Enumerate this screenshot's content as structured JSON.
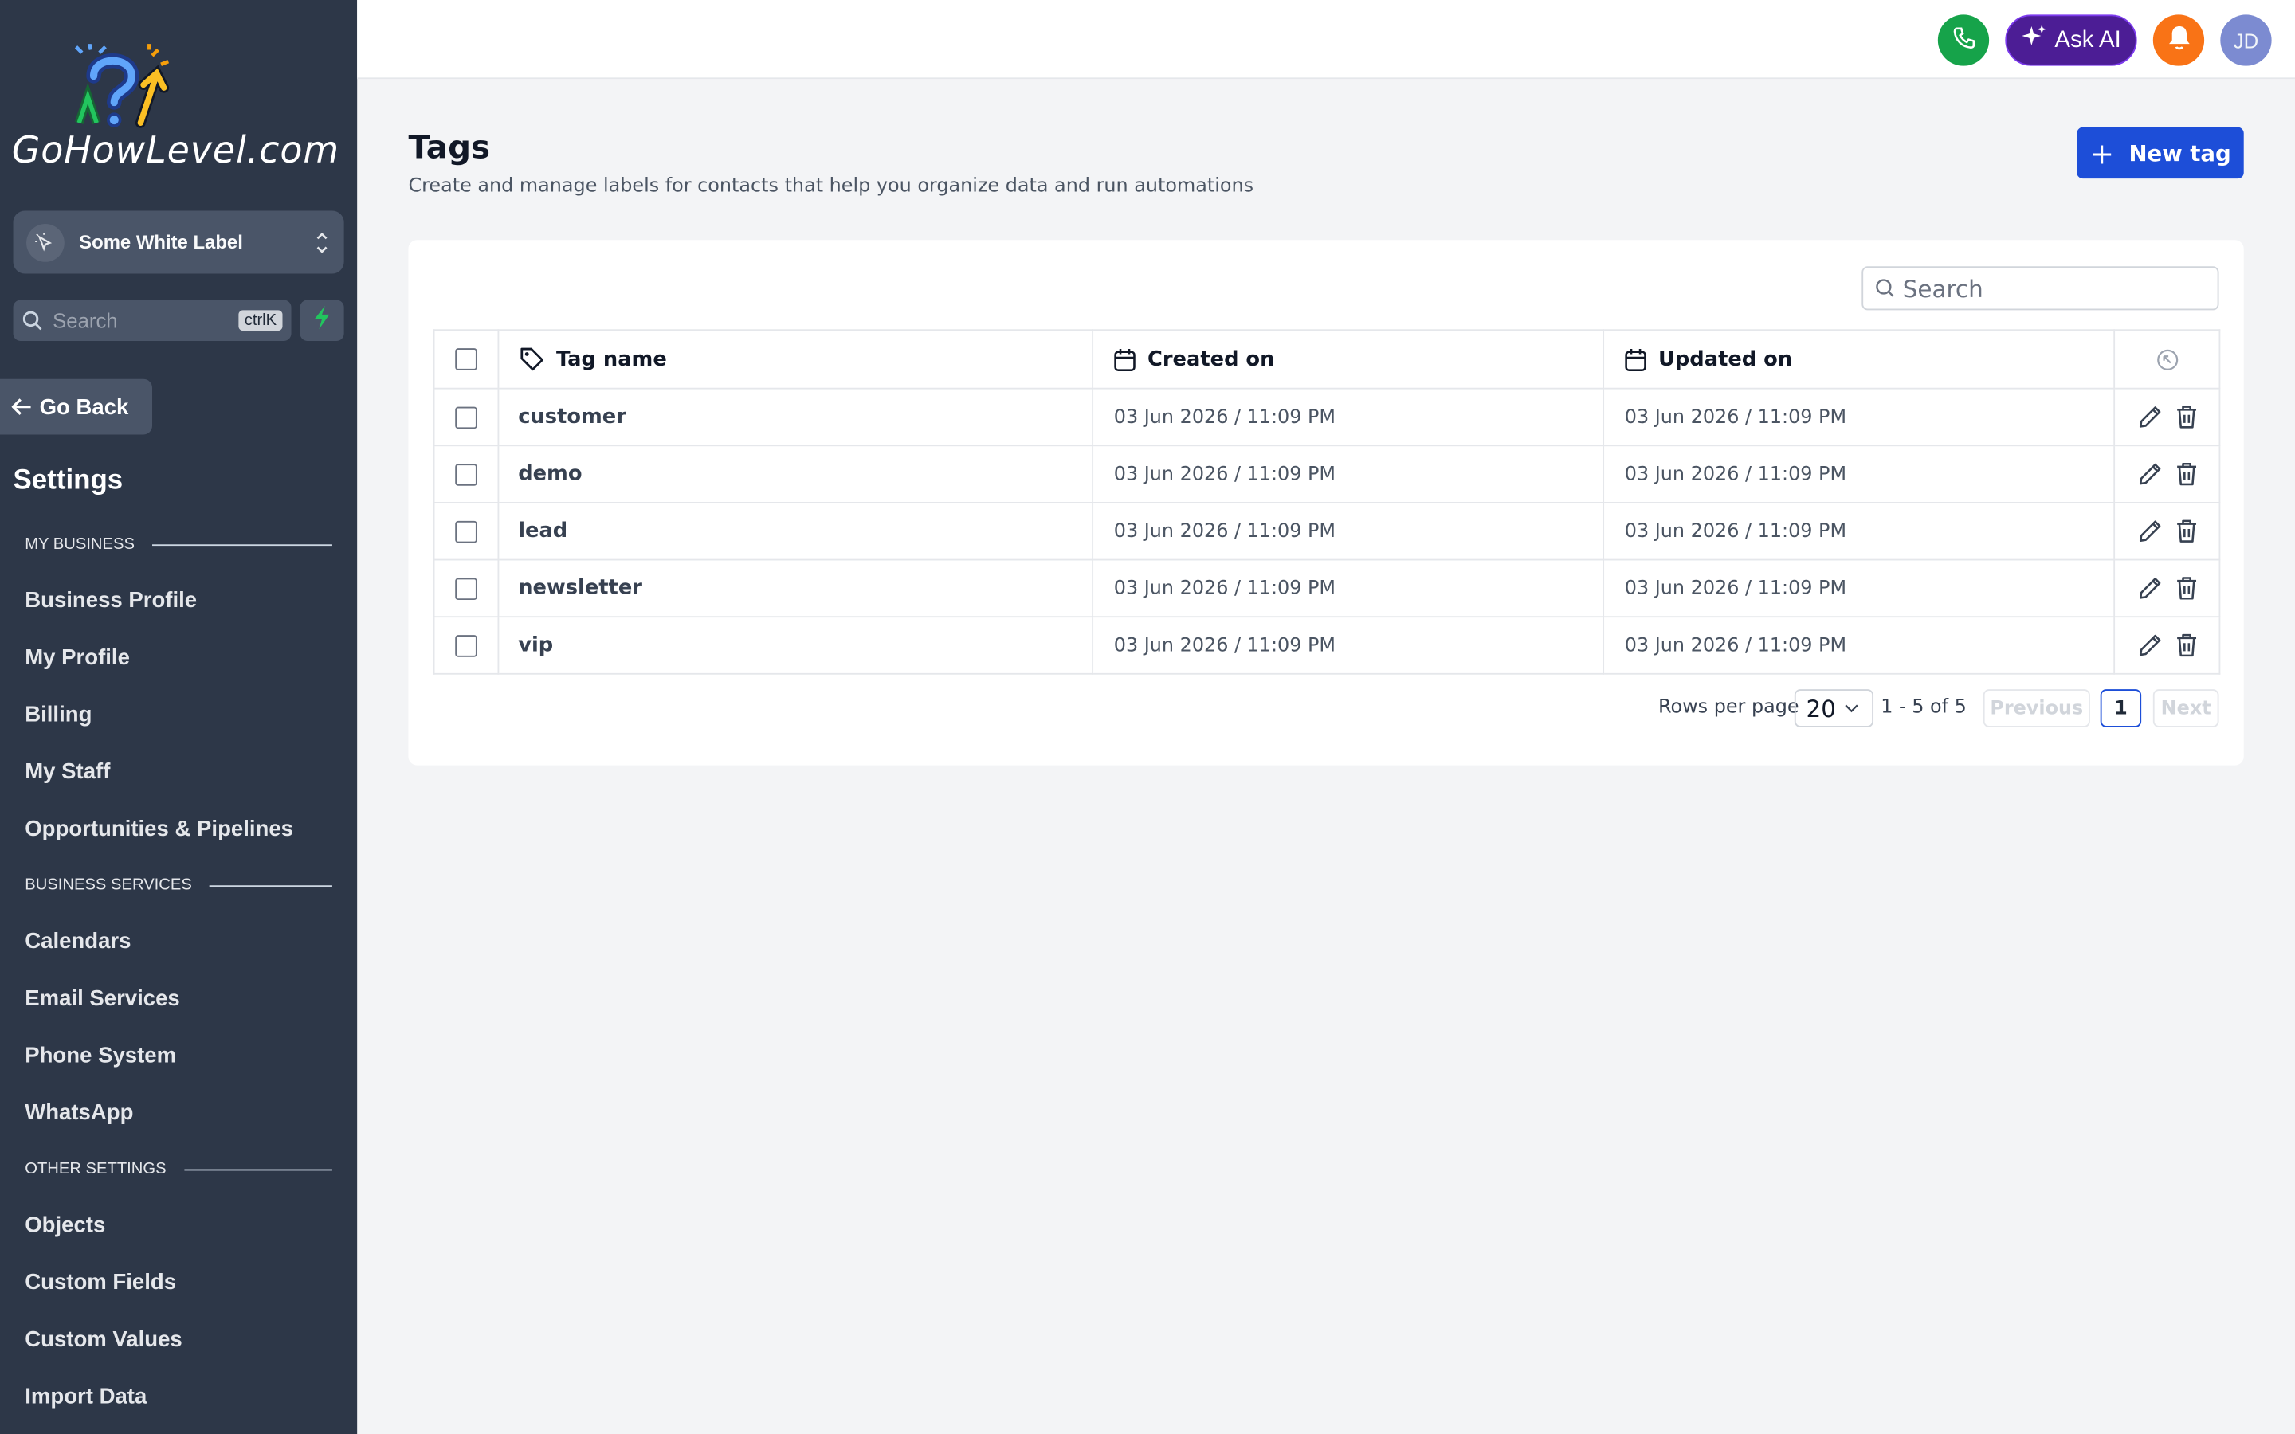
{
  "brand": {
    "logo_text": "GoHowLevel.com"
  },
  "sidebar": {
    "account_name": "Some White Label",
    "search_placeholder": "Search",
    "search_shortcut": "ctrlK",
    "go_back": "Go Back",
    "title": "Settings",
    "sections": [
      {
        "label": "MY BUSINESS",
        "items": [
          "Business Profile",
          "My Profile",
          "Billing",
          "My Staff",
          "Opportunities & Pipelines"
        ]
      },
      {
        "label": "BUSINESS SERVICES",
        "items": [
          "Calendars",
          "Email Services",
          "Phone System",
          "WhatsApp"
        ]
      },
      {
        "label": "OTHER SETTINGS",
        "items": [
          "Objects",
          "Custom Fields",
          "Custom Values",
          "Import Data"
        ]
      }
    ]
  },
  "topbar": {
    "ask_ai": "Ask AI",
    "avatar_initials": "JD",
    "phone_color": "#16a34a",
    "ai_color": "#4c1d95",
    "bell_color": "#f97316"
  },
  "page": {
    "title": "Tags",
    "subtitle": "Create and manage labels for contacts that help you organize data and run automations",
    "new_button": "New tag",
    "search_placeholder": "Search"
  },
  "table": {
    "columns": [
      "Tag name",
      "Created on",
      "Updated on"
    ],
    "rows": [
      {
        "name": "customer",
        "created": "03 Jun 2026 / 11:09 PM",
        "updated": "03 Jun 2026 / 11:09 PM"
      },
      {
        "name": "demo",
        "created": "03 Jun 2026 / 11:09 PM",
        "updated": "03 Jun 2026 / 11:09 PM"
      },
      {
        "name": "lead",
        "created": "03 Jun 2026 / 11:09 PM",
        "updated": "03 Jun 2026 / 11:09 PM"
      },
      {
        "name": "newsletter",
        "created": "03 Jun 2026 / 11:09 PM",
        "updated": "03 Jun 2026 / 11:09 PM"
      },
      {
        "name": "vip",
        "created": "03 Jun 2026 / 11:09 PM",
        "updated": "03 Jun 2026 / 11:09 PM"
      }
    ]
  },
  "pagination": {
    "rows_per_page_label": "Rows per page",
    "rows_per_page": "20",
    "range": "1 - 5 of 5",
    "previous": "Previous",
    "current_page": "1",
    "next": "Next"
  },
  "colors": {
    "sidebar_bg": "#2d3748",
    "accent": "#1d4ed8"
  }
}
